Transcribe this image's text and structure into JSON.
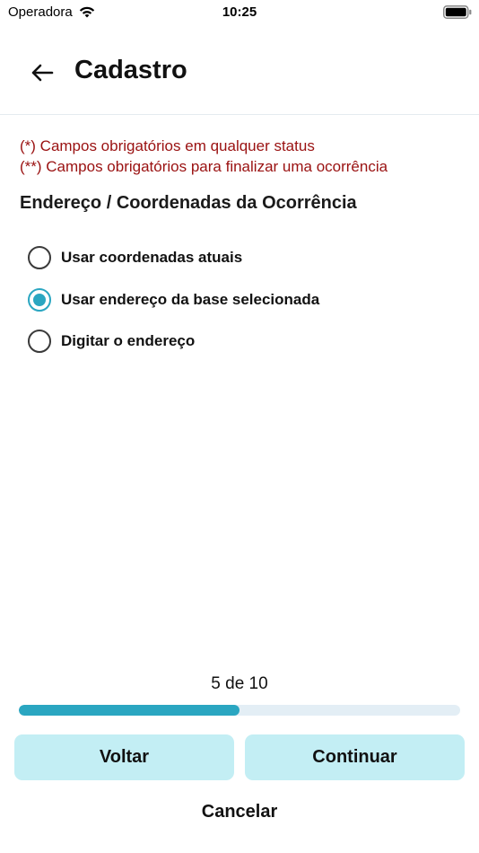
{
  "status_bar": {
    "carrier": "Operadora",
    "time": "10:25",
    "wifi_icon": "wifi-icon",
    "battery_icon": "battery-icon"
  },
  "header": {
    "title": "Cadastro",
    "back_icon": "arrow-left-icon"
  },
  "notes": {
    "line1": "(*) Campos obrigatórios em qualquer status",
    "line2": "(**) Campos obrigatórios para finalizar uma ocorrência"
  },
  "section": {
    "title": "Endereço / Coordenadas da Ocorrência",
    "options": [
      {
        "label": "Usar coordenadas atuais",
        "selected": false
      },
      {
        "label": "Usar endereço da base selecionada",
        "selected": true
      },
      {
        "label": "Digitar o endereço",
        "selected": false
      }
    ]
  },
  "progress": {
    "text": "5 de 10",
    "fraction": 0.5
  },
  "buttons": {
    "back": "Voltar",
    "next": "Continuar",
    "cancel": "Cancelar"
  },
  "colors": {
    "accent": "#2aa6c1",
    "button_bg": "#c3eef4",
    "note_red": "#9a1111",
    "track": "#e3eef5"
  }
}
